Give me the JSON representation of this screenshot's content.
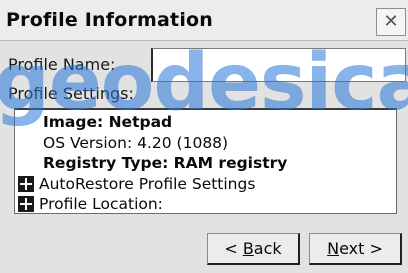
{
  "window": {
    "title": "Profile Information",
    "close_glyph": "✕"
  },
  "form": {
    "profile_name_label": "Profile Name:",
    "profile_name_value": "",
    "profile_settings_label": "Profile Settings:"
  },
  "settings": {
    "image": "Image:  Netpad",
    "os_version": "OS Version:   4.20 (1088)",
    "registry_type": "Registry Type:   RAM registry",
    "autorestore": "AutoRestore Profile Settings",
    "profile_location": "Profile Location:"
  },
  "buttons": {
    "back_prefix": "< ",
    "back_key": "B",
    "back_rest": "ack",
    "next_key": "N",
    "next_rest": "ext >"
  },
  "watermark": {
    "text": "geodesica",
    "color": "#2a78d8"
  },
  "icons": {
    "close": "close-icon",
    "expand": "plus-expand-icon"
  }
}
